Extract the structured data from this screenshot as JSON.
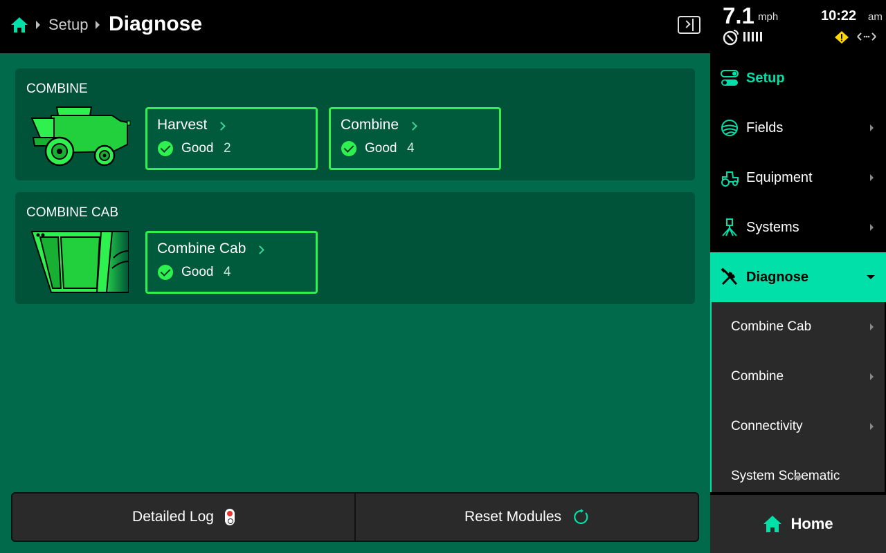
{
  "breadcrumb": {
    "home_icon": "home-icon",
    "parent": "Setup",
    "current": "Diagnose"
  },
  "status": {
    "speed_value": "7.1",
    "speed_unit": "mph",
    "time": "10:22",
    "time_suffix": "am",
    "icons": [
      "gps-icon",
      "signal-bars-icon",
      "warning-icon",
      "connection-icon"
    ]
  },
  "sections": [
    {
      "title": "COMBINE",
      "image": "combine-harvester-illustration",
      "modules": [
        {
          "name": "Harvest",
          "status": "Good",
          "count": "2"
        },
        {
          "name": "Combine",
          "status": "Good",
          "count": "4"
        }
      ]
    },
    {
      "title": "COMBINE CAB",
      "image": "combine-cab-illustration",
      "modules": [
        {
          "name": "Combine Cab",
          "status": "Good",
          "count": "4"
        }
      ]
    }
  ],
  "actions": {
    "detailed_log": "Detailed Log",
    "reset_modules": "Reset Modules"
  },
  "sidebar": {
    "items": [
      {
        "label": "Setup",
        "icon": "toggle-icon"
      },
      {
        "label": "Fields",
        "icon": "fields-icon"
      },
      {
        "label": "Equipment",
        "icon": "tractor-icon"
      },
      {
        "label": "Systems",
        "icon": "sprayer-icon"
      },
      {
        "label": "Diagnose",
        "icon": "wrench-screwdriver-icon"
      }
    ],
    "submenu": [
      {
        "label": "Combine Cab"
      },
      {
        "label": "Combine"
      },
      {
        "label": "Connectivity"
      },
      {
        "label": "System Schematic"
      }
    ],
    "home_label": "Home"
  },
  "colors": {
    "accent": "#00e0a8",
    "main_bg": "#006a4a",
    "card_bg": "#005338",
    "tile_border": "#2ef04e",
    "good": "#2ef04e",
    "warning": "#ffd600"
  }
}
